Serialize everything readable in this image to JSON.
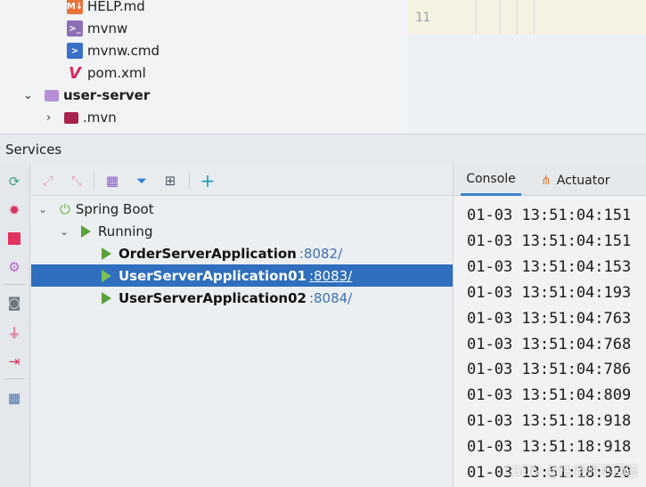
{
  "project_tree": {
    "items": [
      {
        "label": "HELP.md",
        "icon": "markdown-file-icon"
      },
      {
        "label": "mvnw",
        "icon": "shell-script-icon"
      },
      {
        "label": "mvnw.cmd",
        "icon": "powershell-script-icon"
      },
      {
        "label": "pom.xml",
        "icon": "maven-pom-icon"
      },
      {
        "label": "user-server",
        "icon": "module-folder-icon"
      },
      {
        "label": ".mvn",
        "icon": "folder-icon"
      }
    ]
  },
  "editor": {
    "line_number": "11"
  },
  "services": {
    "title": "Services",
    "tree": {
      "root": "Spring Boot",
      "group": "Running",
      "apps": [
        {
          "name": "OrderServerApplication",
          "port": ":8082/"
        },
        {
          "name": "UserServerApplication01",
          "port": ":8083/"
        },
        {
          "name": "UserServerApplication02",
          "port": ":8084/"
        }
      ]
    }
  },
  "console": {
    "tabs": [
      "Console",
      "Actuator"
    ],
    "lines": [
      "01-03 13:51:04:151",
      "01-03 13:51:04:151",
      "01-03 13:51:04:153",
      "01-03 13:51:04:193",
      "01-03 13:51:04:763",
      "01-03 13:51:04:768",
      "01-03 13:51:04:786",
      "01-03 13:51:04:809",
      "01-03 13:51:18:918",
      "01-03 13:51:18:918",
      "01-03 13:51:18:920"
    ]
  },
  "watermark": "CSDN @枯老师不回答",
  "colors": {
    "selection": "#2f6fbd",
    "run_green": "#5aa23a",
    "port_link": "#3e70b5"
  }
}
